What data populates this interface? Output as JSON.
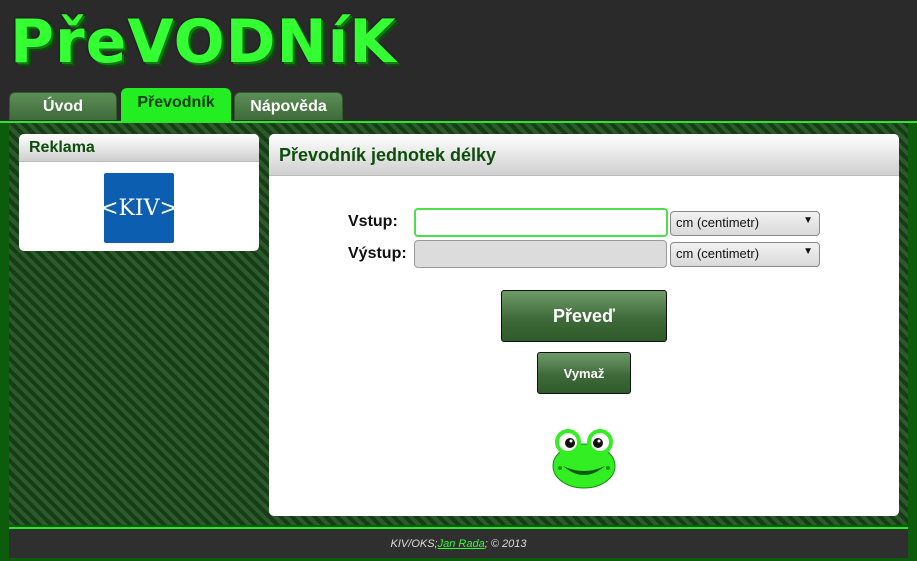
{
  "header": {
    "logo_text": "PřeVODNíK",
    "tabs": [
      {
        "label": "Úvod",
        "active": false
      },
      {
        "label": "Převodník",
        "active": true
      },
      {
        "label": "Nápověda",
        "active": false
      }
    ]
  },
  "sidebar": {
    "ad_title": "Reklama",
    "ad_logo_text": "<KIV>"
  },
  "converter": {
    "title": "Převodník jednotek délky",
    "input_label": "Vstup:",
    "input_value": "",
    "input_unit": "cm (centimetr)",
    "output_label": "Výstup:",
    "output_value": "",
    "output_unit": "cm (centimetr)",
    "convert_label": "Převeď",
    "clear_label": "Vymaž"
  },
  "footer": {
    "prefix": "KIV/OKS; ",
    "author": "Jan Rada",
    "suffix": "; © 2013"
  },
  "colors": {
    "accent": "#33ff33",
    "tab_active": "#22ee22",
    "button_green": "#3f6b3a",
    "brand_blue": "#0c5fb0"
  }
}
